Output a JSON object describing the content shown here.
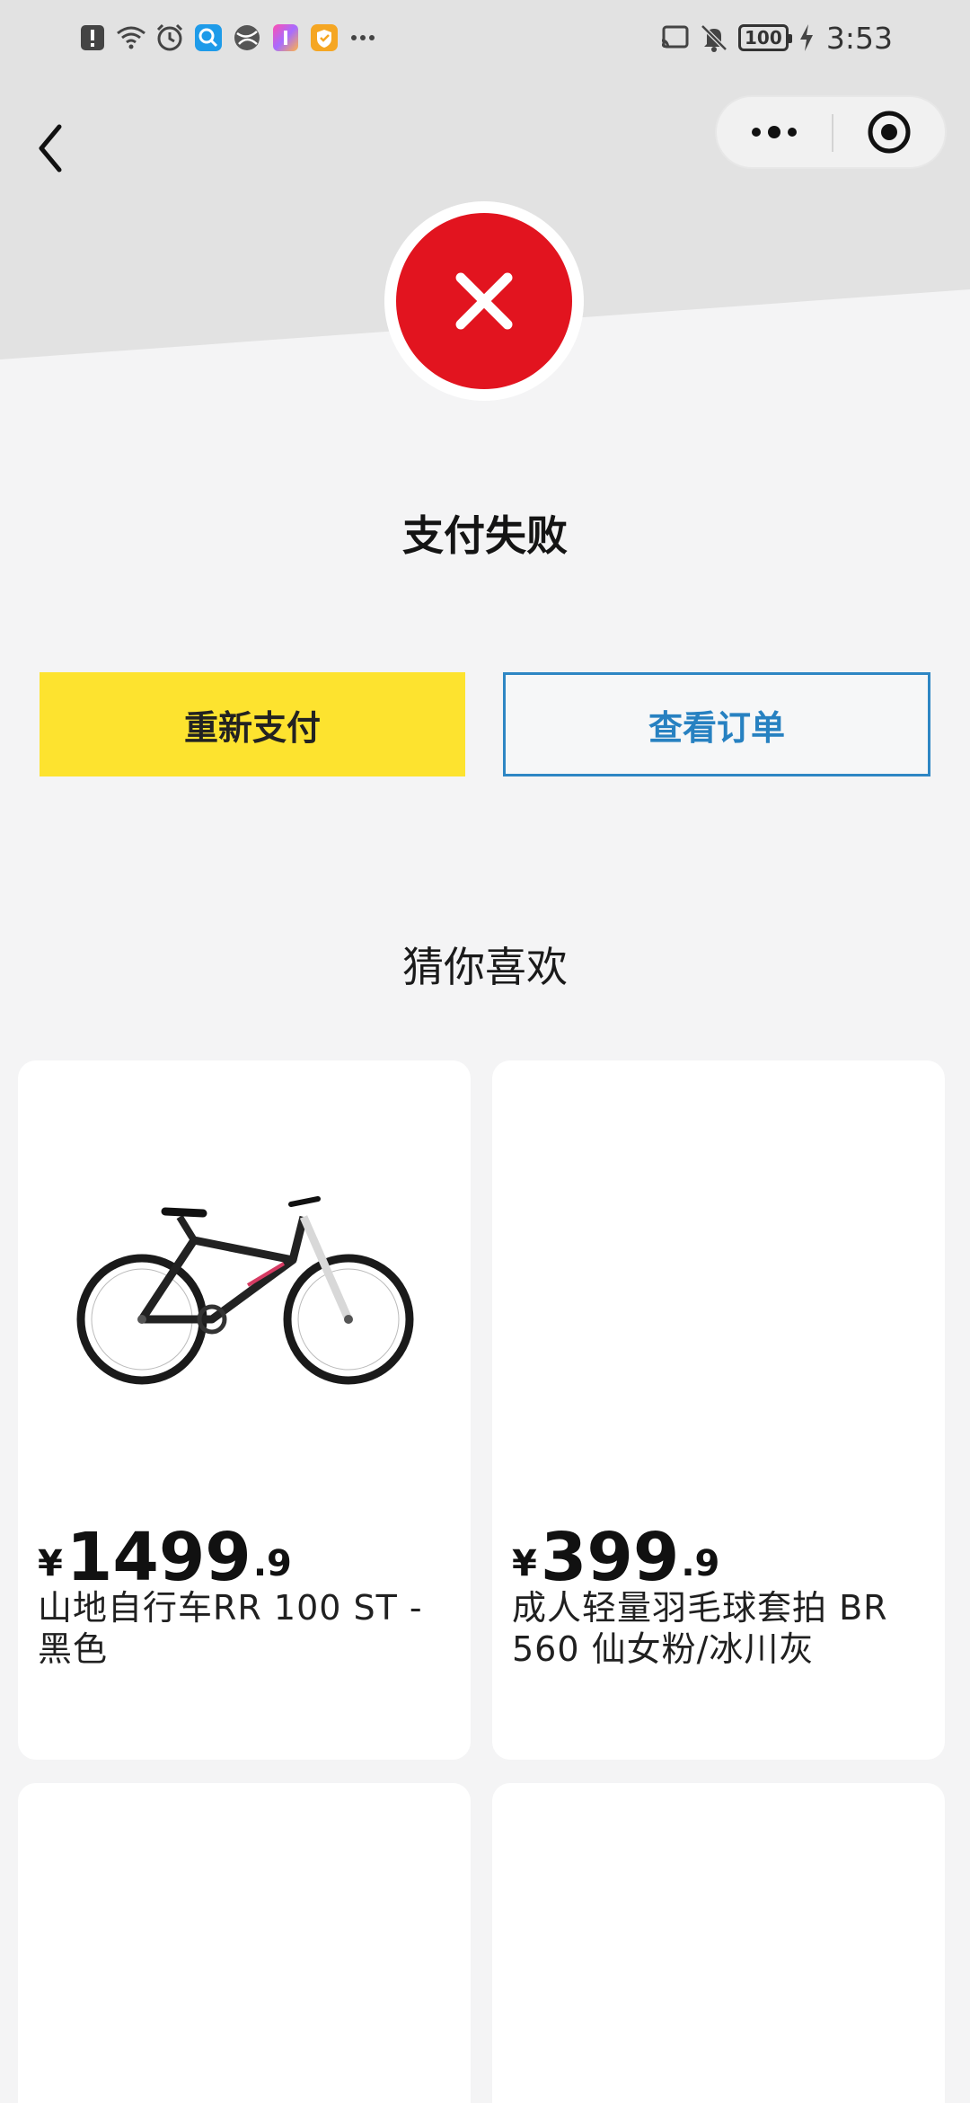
{
  "status_bar": {
    "time": "3:53",
    "battery": "100",
    "left_icons": [
      "alert-icon",
      "wifi-icon",
      "alarm-icon",
      "search-app-icon",
      "browser-app-icon",
      "color-app-icon",
      "shield-app-icon",
      "more-dots-icon"
    ],
    "right_icons": [
      "cast-icon",
      "mute-icon",
      "battery-icon",
      "charging-icon"
    ]
  },
  "nav": {
    "back_icon": "chevron-left-icon",
    "more_icon": "more-dots-icon",
    "close_icon": "target-close-icon"
  },
  "result": {
    "icon": "close-x-icon",
    "icon_color": "#e2141f",
    "title": "支付失败"
  },
  "actions": {
    "repay_label": "重新支付",
    "view_order_label": "查看订单",
    "repay_color": "#fde32f",
    "order_color": "#2781c1"
  },
  "recommend": {
    "title": "猜你喜欢",
    "products": [
      {
        "currency": "¥",
        "price_int": "1499",
        "price_dec": ".9",
        "name": "山地自行车RR 100 ST - 黑色",
        "image": "mountain-bike-image"
      },
      {
        "currency": "¥",
        "price_int": "399",
        "price_dec": ".9",
        "name": "成人轻量羽毛球套拍 BR 560 仙女粉/冰川灰",
        "image": ""
      }
    ]
  }
}
